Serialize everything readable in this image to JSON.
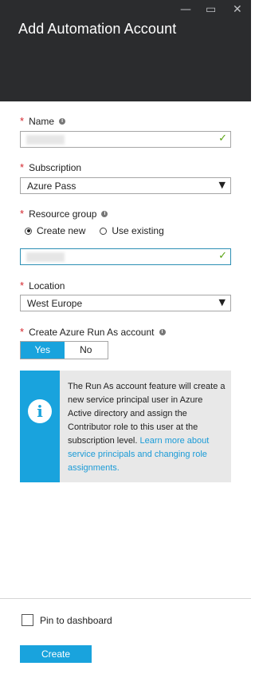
{
  "header": {
    "title": "Add Automation Account",
    "minimize_glyph": "—",
    "maximize_glyph": "▭",
    "close_glyph": "✕"
  },
  "form": {
    "required_mark": "*",
    "name": {
      "label": "Name",
      "value_redacted": true
    },
    "subscription": {
      "label": "Subscription",
      "selected": "Azure Pass"
    },
    "resource_group": {
      "label": "Resource group",
      "options": [
        "Create new",
        "Use existing"
      ],
      "selected_option": "Create new",
      "value_redacted": true
    },
    "location": {
      "label": "Location",
      "selected": "West Europe"
    },
    "run_as": {
      "label": "Create Azure Run As account",
      "yes": "Yes",
      "no": "No",
      "selected": "Yes"
    }
  },
  "info_box": {
    "icon": "info-icon",
    "text": "The Run As account feature will create a new service principal user in Azure Active directory and assign the Contributor role to this user at the subscription level.",
    "link": "Learn more about service principals and changing role assignments."
  },
  "footer": {
    "pin_label": "Pin to dashboard",
    "pin_checked": false,
    "create_label": "Create"
  },
  "colors": {
    "header_bg": "#2b2c2e",
    "accent": "#19a3dd",
    "required": "#d4242b",
    "valid_check": "#5aa313",
    "info_bg": "#e8e8e8"
  }
}
